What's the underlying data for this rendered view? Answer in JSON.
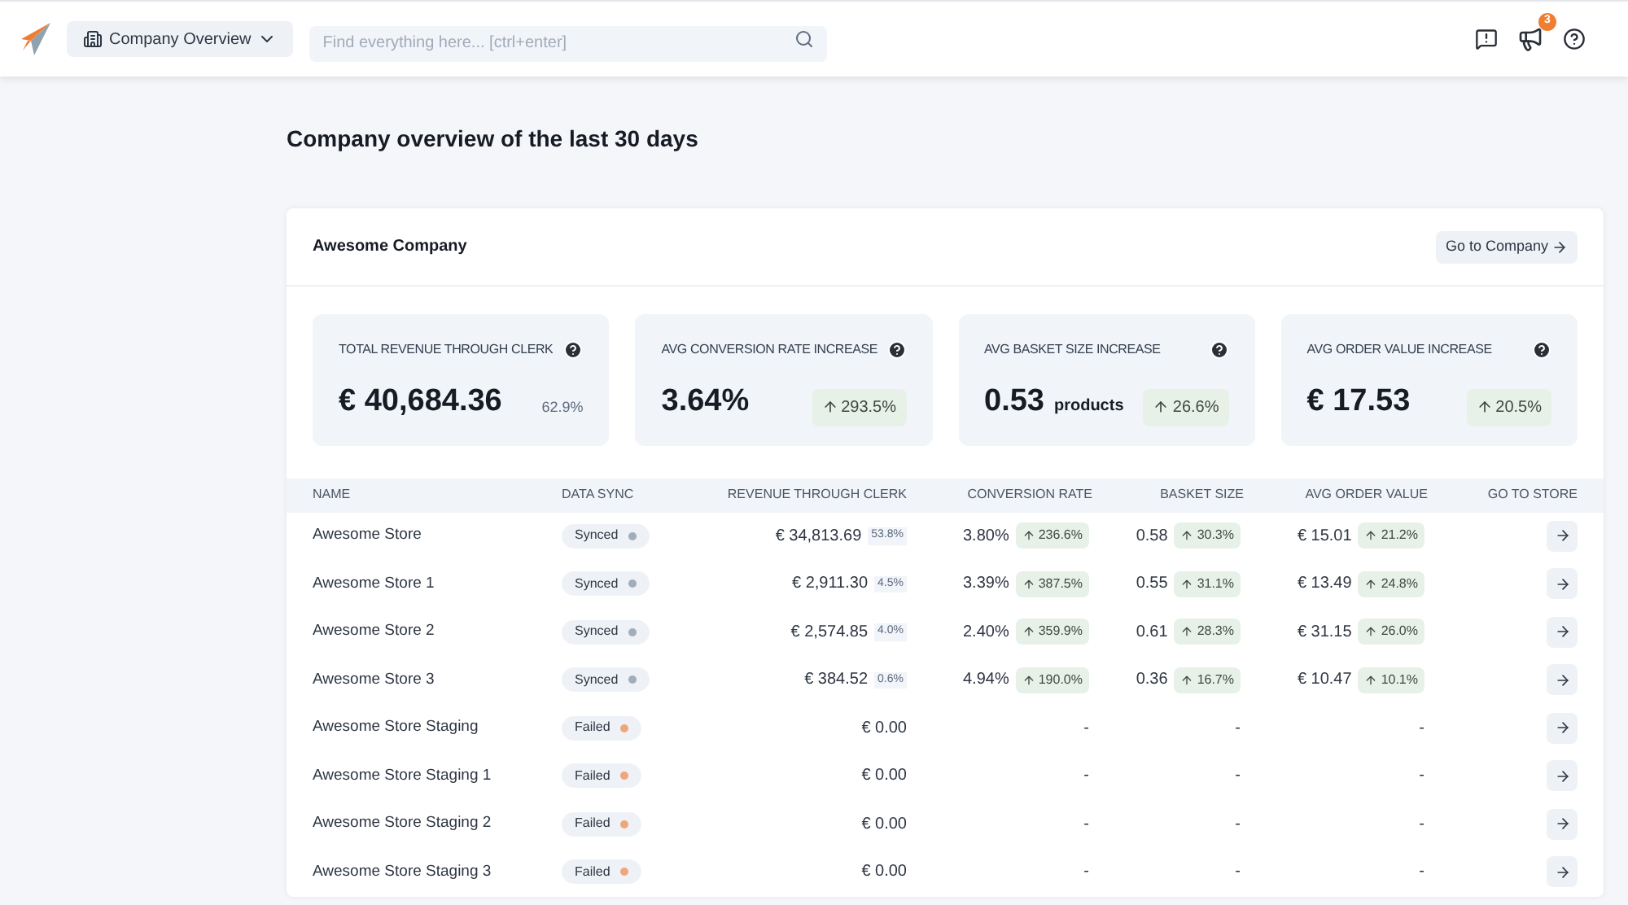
{
  "header": {
    "nav_label": "Company Overview",
    "search": {
      "placeholder": "Find everything here... [ctrl+enter]"
    },
    "notification_count": "3"
  },
  "page_title": "Company overview of the last 30 days",
  "company": {
    "name": "Awesome Company",
    "go_button": "Go to Company",
    "kpis": [
      {
        "label": "TOTAL REVENUE THROUGH CLERK",
        "value": "€ 40,684.36",
        "change": "62.9%",
        "kind": "plain"
      },
      {
        "label": "AVG CONVERSION RATE INCREASE",
        "value": "3.64%",
        "change": "293.5%",
        "kind": "increase"
      },
      {
        "label": "AVG BASKET SIZE INCREASE",
        "value": "0.53",
        "unit": "products",
        "change": "26.6%",
        "kind": "increase"
      },
      {
        "label": "AVG ORDER VALUE INCREASE",
        "value": "€ 17.53",
        "change": "20.5%",
        "kind": "increase"
      }
    ],
    "table": {
      "columns": [
        "NAME",
        "DATA SYNC",
        "REVENUE THROUGH CLERK",
        "CONVERSION RATE",
        "BASKET SIZE",
        "AVG ORDER VALUE",
        "GO TO STORE"
      ],
      "rows": [
        {
          "name": "Awesome Store",
          "sync": {
            "label": "Synced",
            "color": "#a3acb9"
          },
          "revenue": {
            "value": "€ 34,813.69",
            "share": "53.8%"
          },
          "conversion": {
            "value": "3.80%",
            "change": "236.6%"
          },
          "basket": {
            "value": "0.58",
            "change": "30.3%"
          },
          "order_value": {
            "value": "€ 15.01",
            "change": "21.2%"
          }
        },
        {
          "name": "Awesome Store 1",
          "sync": {
            "label": "Synced",
            "color": "#a3acb9"
          },
          "revenue": {
            "value": "€ 2,911.30",
            "share": "4.5%"
          },
          "conversion": {
            "value": "3.39%",
            "change": "387.5%"
          },
          "basket": {
            "value": "0.55",
            "change": "31.1%"
          },
          "order_value": {
            "value": "€ 13.49",
            "change": "24.8%"
          }
        },
        {
          "name": "Awesome Store 2",
          "sync": {
            "label": "Synced",
            "color": "#a3acb9"
          },
          "revenue": {
            "value": "€ 2,574.85",
            "share": "4.0%"
          },
          "conversion": {
            "value": "2.40%",
            "change": "359.9%"
          },
          "basket": {
            "value": "0.61",
            "change": "28.3%"
          },
          "order_value": {
            "value": "€ 31.15",
            "change": "26.0%"
          }
        },
        {
          "name": "Awesome Store 3",
          "sync": {
            "label": "Synced",
            "color": "#a3acb9"
          },
          "revenue": {
            "value": "€ 384.52",
            "share": "0.6%"
          },
          "conversion": {
            "value": "4.94%",
            "change": "190.0%"
          },
          "basket": {
            "value": "0.36",
            "change": "16.7%"
          },
          "order_value": {
            "value": "€ 10.47",
            "change": "10.1%"
          }
        },
        {
          "name": "Awesome Store Staging",
          "sync": {
            "label": "Failed",
            "color": "#f0a57c"
          },
          "revenue": {
            "value": "€ 0.00"
          },
          "conversion": {
            "value": "-"
          },
          "basket": {
            "value": "-"
          },
          "order_value": {
            "value": "-"
          }
        },
        {
          "name": "Awesome Store Staging 1",
          "sync": {
            "label": "Failed",
            "color": "#f0a57c"
          },
          "revenue": {
            "value": "€ 0.00"
          },
          "conversion": {
            "value": "-"
          },
          "basket": {
            "value": "-"
          },
          "order_value": {
            "value": "-"
          }
        },
        {
          "name": "Awesome Store Staging 2",
          "sync": {
            "label": "Failed",
            "color": "#f0a57c"
          },
          "revenue": {
            "value": "€ 0.00"
          },
          "conversion": {
            "value": "-"
          },
          "basket": {
            "value": "-"
          },
          "order_value": {
            "value": "-"
          }
        },
        {
          "name": "Awesome Store Staging 3",
          "sync": {
            "label": "Failed",
            "color": "#f0a57c"
          },
          "revenue": {
            "value": "€ 0.00"
          },
          "conversion": {
            "value": "-"
          },
          "basket": {
            "value": "-"
          },
          "order_value": {
            "value": "-"
          }
        }
      ]
    }
  }
}
